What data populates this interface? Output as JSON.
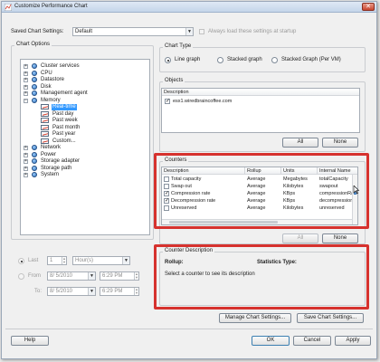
{
  "window": {
    "title": "Customize Performance Chart",
    "close_label": "✕"
  },
  "saved_settings": {
    "label": "Saved Chart Settings:",
    "value": "Default",
    "always_load_label": "Always load these settings at startup",
    "always_load_checked": false
  },
  "chart_options": {
    "title": "Chart Options",
    "tree": [
      {
        "label": "Cluster services",
        "type": "node"
      },
      {
        "label": "CPU",
        "type": "node"
      },
      {
        "label": "Datastore",
        "type": "node"
      },
      {
        "label": "Disk",
        "type": "node"
      },
      {
        "label": "Management agent",
        "type": "node"
      },
      {
        "label": "Memory",
        "type": "node-open"
      },
      {
        "label": "Real-time",
        "type": "leaf",
        "selected": true
      },
      {
        "label": "Past day",
        "type": "leaf"
      },
      {
        "label": "Past week",
        "type": "leaf"
      },
      {
        "label": "Past month",
        "type": "leaf"
      },
      {
        "label": "Past year",
        "type": "leaf"
      },
      {
        "label": "Custom...",
        "type": "leaf"
      },
      {
        "label": "Network",
        "type": "node"
      },
      {
        "label": "Power",
        "type": "node"
      },
      {
        "label": "Storage adapter",
        "type": "node"
      },
      {
        "label": "Storage path",
        "type": "node"
      },
      {
        "label": "System",
        "type": "node"
      }
    ]
  },
  "timespan": {
    "last_label": "Last",
    "last_value": "1",
    "last_unit": "Hour(s)",
    "from_label": "From",
    "from_date": "8/ 5/2010",
    "from_time": "6:29 PM",
    "to_label": "To:",
    "to_date": "8/ 5/2010",
    "to_time": "6:29 PM"
  },
  "chart_type": {
    "title": "Chart Type",
    "options": [
      "Line graph",
      "Stacked graph",
      "Stacked Graph (Per VM)"
    ],
    "selected_index": 0
  },
  "objects": {
    "title": "Objects",
    "header": "Description",
    "items": [
      {
        "label": "esx1.wiredbraincoffee.com",
        "checked": true
      }
    ],
    "all_label": "All",
    "none_label": "None"
  },
  "counters": {
    "title": "Counters",
    "columns": [
      "Description",
      "Rollup",
      "Units",
      "Internal Name"
    ],
    "rows": [
      {
        "checked": false,
        "description": "Total capacity",
        "rollup": "Average",
        "units": "Megabytes",
        "internal": "totalCapacity"
      },
      {
        "checked": false,
        "description": "Swap out",
        "rollup": "Average",
        "units": "Kilobytes",
        "internal": "swapout"
      },
      {
        "checked": true,
        "description": "Compression rate",
        "rollup": "Average",
        "units": "KBps",
        "internal": "compressionRate"
      },
      {
        "checked": true,
        "description": "Decompression rate",
        "rollup": "Average",
        "units": "KBps",
        "internal": "decompressionRate"
      },
      {
        "checked": false,
        "description": "Unreserved",
        "rollup": "Average",
        "units": "Kilobytes",
        "internal": "unreserved"
      }
    ],
    "all_label": "All",
    "none_label": "None"
  },
  "counter_description": {
    "title": "Counter Description",
    "rollup_label": "Rollup:",
    "stats_label": "Statistics Type:",
    "hint": "Select a counter to see its description"
  },
  "footer": {
    "manage_label": "Manage Chart Settings...",
    "save_label": "Save Chart Settings...",
    "help_label": "Help",
    "ok_label": "OK",
    "cancel_label": "Cancel",
    "apply_label": "Apply"
  },
  "colors": {
    "highlight": "#d6322e",
    "selection": "#3399ff"
  }
}
